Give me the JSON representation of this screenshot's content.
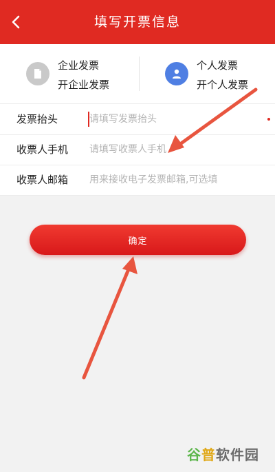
{
  "header": {
    "title": "填写开票信息"
  },
  "invoice_types": {
    "company": {
      "name": "企业发票",
      "sub": "开企业发票"
    },
    "personal": {
      "name": "个人发票",
      "sub": "开个人发票"
    }
  },
  "form": {
    "title_row": {
      "label": "发票抬头",
      "placeholder": "请填写发票抬头"
    },
    "phone_row": {
      "label": "收票人手机",
      "placeholder": "请填写收票人手机"
    },
    "email_row": {
      "label": "收票人邮箱",
      "placeholder": "用来接收电子发票邮箱,可选填"
    }
  },
  "confirm_label": "确定",
  "watermark": {
    "part1": "谷",
    "part2": "普",
    "part3": "软件园"
  },
  "colors": {
    "brand_red": "#e02a22",
    "personal_icon_blue": "#4f7fe3",
    "annotation_arrow": "#e8553f"
  }
}
